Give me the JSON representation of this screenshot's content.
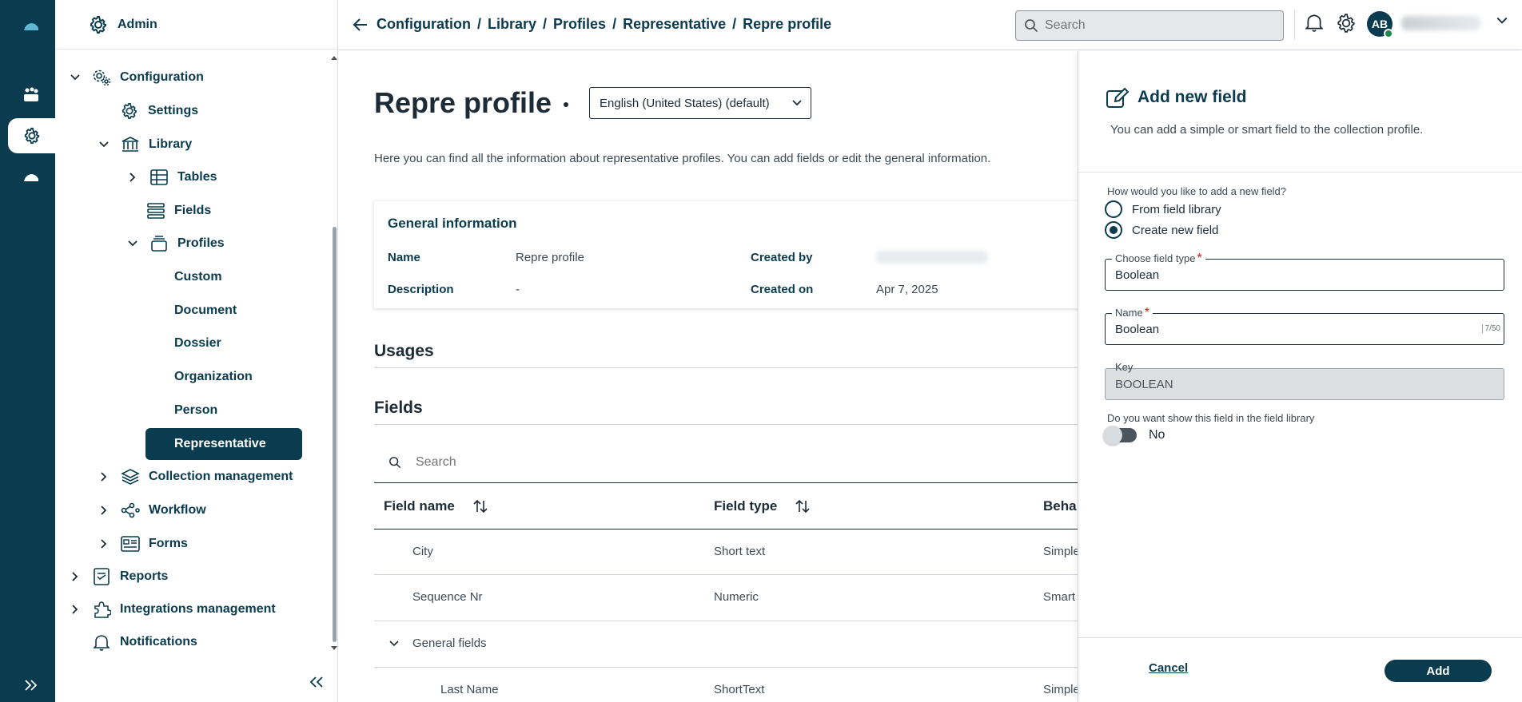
{
  "sidebar": {
    "header": "Admin",
    "items": [
      {
        "label": "Configuration"
      },
      {
        "label": "Settings"
      },
      {
        "label": "Library"
      },
      {
        "label": "Tables"
      },
      {
        "label": "Fields"
      },
      {
        "label": "Profiles"
      },
      {
        "label": "Custom"
      },
      {
        "label": "Document"
      },
      {
        "label": "Dossier"
      },
      {
        "label": "Organization"
      },
      {
        "label": "Person"
      },
      {
        "label": "Representative"
      },
      {
        "label": "Collection management"
      },
      {
        "label": "Workflow"
      },
      {
        "label": "Forms"
      },
      {
        "label": "Reports"
      },
      {
        "label": "Integrations management"
      },
      {
        "label": "Notifications"
      }
    ]
  },
  "topbar": {
    "breadcrumb": [
      "Configuration",
      "/",
      "Library",
      "/",
      "Profiles",
      "/",
      "Representative",
      "/",
      "Repre profile"
    ],
    "search_placeholder": "Search",
    "avatar_initials": "AB"
  },
  "main": {
    "title": "Repre profile",
    "language": "English (United States) (default)",
    "intro": "Here you can find all the information about representative profiles. You can add fields or edit the general information.",
    "general": {
      "title": "General information",
      "name_label": "Name",
      "name_value": "Repre profile",
      "description_label": "Description",
      "description_value": "-",
      "created_by_label": "Created by",
      "created_on_label": "Created on",
      "created_on_value": "Apr 7, 2025"
    },
    "usages_title": "Usages",
    "fields_title": "Fields",
    "table_search_placeholder": "Search",
    "columns": [
      "Field name",
      "Field type",
      "Beha"
    ],
    "rows": [
      {
        "name": "City",
        "type": "Short text",
        "behavior": "Simple"
      },
      {
        "name": "Sequence Nr",
        "type": "Numeric",
        "behavior": "Smart"
      },
      {
        "name": "General fields",
        "type": "",
        "behavior": ""
      },
      {
        "name": "Last Name",
        "type": "ShortText",
        "behavior": "Simple"
      }
    ]
  },
  "panel": {
    "title": "Add new field",
    "subtitle": "You can add a simple or smart field to the collection profile.",
    "question": "How would you like to add a new field?",
    "option_library": "From field library",
    "option_create": "Create new field",
    "field_type_label": "Choose field type",
    "field_type_value": "Boolean",
    "name_label": "Name",
    "name_value": "Boolean",
    "name_counter": "7/50",
    "key_label": "Key",
    "key_value": "BOOLEAN",
    "library_question": "Do you want show this field in the field library",
    "toggle_label": "No",
    "cancel": "Cancel",
    "add": "Add"
  },
  "colors": {
    "primary": "#0a3b4e",
    "required": "#dd1111"
  }
}
